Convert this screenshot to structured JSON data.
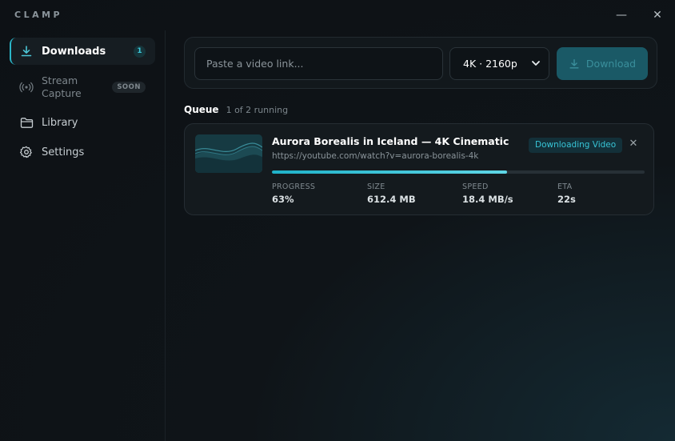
{
  "app": {
    "brand": "CLAMP",
    "minimize_glyph": "—",
    "close_glyph": "✕"
  },
  "sidebar": {
    "items": [
      {
        "label": "Downloads",
        "icon": "download-icon",
        "badge": "1",
        "active": true
      },
      {
        "label": "Stream Capture",
        "label_line1": "Stream",
        "label_line2": "Capture",
        "icon": "broadcast-icon",
        "badge": "SOON",
        "active": false
      },
      {
        "label": "Library",
        "icon": "folder-icon",
        "active": false
      },
      {
        "label": "Settings",
        "icon": "gear-icon",
        "active": false
      }
    ]
  },
  "input": {
    "url_placeholder": "Paste a video link...",
    "quality_selected": "4K · 2160p",
    "download_label": "Download"
  },
  "queue": {
    "title": "Queue",
    "subtitle": "1 of 2 running",
    "items": [
      {
        "title": "Aurora Borealis in Iceland — 4K Cinematic",
        "url": "https://youtube.com/watch?v=aurora-borealis-4k",
        "status": "Downloading Video",
        "progress_percent": 63,
        "stats": [
          {
            "label": "PROGRESS",
            "value": "63%"
          },
          {
            "label": "SIZE",
            "value": "612.4 MB"
          },
          {
            "label": "SPEED",
            "value": "18.4 MB/s"
          },
          {
            "label": "ETA",
            "value": "22s"
          }
        ]
      }
    ]
  },
  "colors": {
    "accent": "#2bb6c9",
    "background": "#0f1418",
    "status_badge_bg": "#133039"
  }
}
